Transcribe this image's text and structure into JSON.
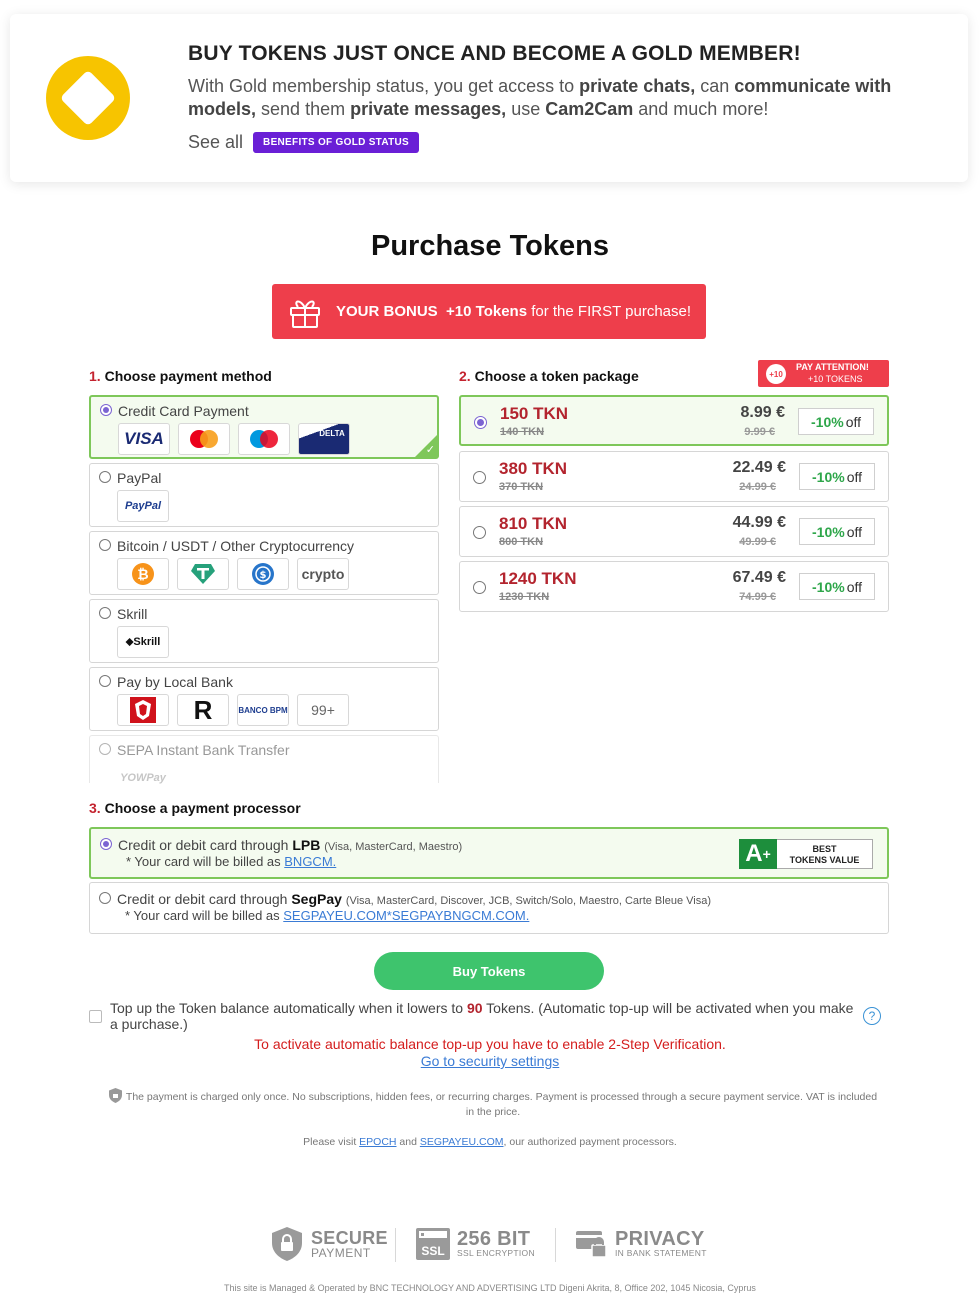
{
  "gold": {
    "title": "BUY TOKENS JUST ONCE AND BECOME A GOLD MEMBER!",
    "text_1": "With Gold membership status, you get access to ",
    "text_b1": "private chats,",
    "text_2": " can ",
    "text_b2": "communicate with models,",
    "text_3": " send them ",
    "text_b3": "private messages,",
    "text_4": " use ",
    "text_b4": "Cam2Cam",
    "text_5": " and much more!",
    "see_all": "See all",
    "benefits_badge": "BENEFITS OF GOLD STATUS",
    "brand_color": "#f7c400"
  },
  "page_title": "Purchase Tokens",
  "bonus": {
    "prefix": "YOUR BONUS",
    "amount": "+10 Tokens",
    "suffix": "for the FIRST purchase!",
    "color": "#ee3e4b"
  },
  "sections": {
    "payment_method": {
      "num": "1.",
      "label": "Choose payment method"
    },
    "token_package": {
      "num": "2.",
      "label": "Choose a token package"
    },
    "processor": {
      "num": "3.",
      "label": "Choose a payment processor"
    }
  },
  "payment_methods": [
    {
      "label": "Credit Card Payment",
      "icons": [
        "VISA",
        "mastercard",
        "maestro",
        "DELTA"
      ]
    },
    {
      "label": "PayPal",
      "icons": [
        "PayPal"
      ]
    },
    {
      "label": "Bitcoin / USDT / Other Cryptocurrency",
      "icons": [
        "bitcoin",
        "tether",
        "usdc",
        "crypto"
      ]
    },
    {
      "label": "Skrill",
      "icons": [
        "Skrill"
      ]
    },
    {
      "label": "Pay by Local Bank",
      "icons": [
        "bank-crest",
        "R",
        "BANCO BPM",
        "99+"
      ]
    },
    {
      "label": "SEPA Instant Bank Transfer",
      "icons": [
        "YOWPay"
      ]
    }
  ],
  "attention": {
    "badge": "+10",
    "line1": "PAY ATTENTION!",
    "line2": "+10 TOKENS"
  },
  "packages": [
    {
      "tokens": "150 TKN",
      "old_tokens": "140 TKN",
      "price": "8.99 €",
      "old_price": "9.99 €",
      "discount": "-10%",
      "off": "off"
    },
    {
      "tokens": "380 TKN",
      "old_tokens": "370 TKN",
      "price": "22.49 €",
      "old_price": "24.99 €",
      "discount": "-10%",
      "off": "off"
    },
    {
      "tokens": "810 TKN",
      "old_tokens": "800 TKN",
      "price": "44.99 €",
      "old_price": "49.99 €",
      "discount": "-10%",
      "off": "off"
    },
    {
      "tokens": "1240 TKN",
      "old_tokens": "1230 TKN",
      "price": "67.49 €",
      "old_price": "74.99 €",
      "discount": "-10%",
      "off": "off"
    }
  ],
  "processors": [
    {
      "prefix": "Credit or debit card through ",
      "name": "LPB",
      "cards": "(Visa, MasterCard, Maestro)",
      "billed": "* Your card will be billed as ",
      "billed_as": "BNGCM."
    },
    {
      "prefix": "Credit or debit card through ",
      "name": "SegPay",
      "cards": "(Visa, MasterCard, Discover, JCB, Switch/Solo, Maestro, Carte Bleue Visa)",
      "billed": "* Your card will be billed as ",
      "billed_as": "SEGPAYEU.COM*SEGPAYBNGCM.COM."
    }
  ],
  "best_value": {
    "grade": "A",
    "line1": "BEST",
    "line2": "TOKENS VALUE"
  },
  "buy_button": "Buy Tokens",
  "topup": {
    "text_1": "Top up the Token balance automatically when it lowers to ",
    "amount": "90",
    "text_2": " Tokens. (Automatic top-up will be activated when you make a purchase.)",
    "help": "?"
  },
  "warning": "To activate automatic balance top-up you have to enable 2-Step Verification.",
  "security_link": "Go to security settings",
  "note": "The payment is charged only once. No subscriptions, hidden fees, or recurring charges. Payment is processed through a secure payment service. VAT is included in the price.",
  "visit": {
    "prefix": "Please visit ",
    "epoch": "EPOCH",
    "and": " and ",
    "segpay": "SEGPAYEU.COM",
    "suffix": ", our authorized payment processors."
  },
  "trust": {
    "secure_1": "SECURE",
    "secure_2": "PAYMENT",
    "ssl_badge": "SSL",
    "ssl_1": "256 BIT",
    "ssl_2": "SSL ENCRYPTION",
    "privacy_1": "PRIVACY",
    "privacy_2": "IN BANK STATEMENT"
  },
  "footer": "This site is Managed & Operated by BNC TECHNOLOGY AND ADVERTISING LTD Digeni Akrita, 8, Office 202, 1045 Nicosia, Cyprus"
}
